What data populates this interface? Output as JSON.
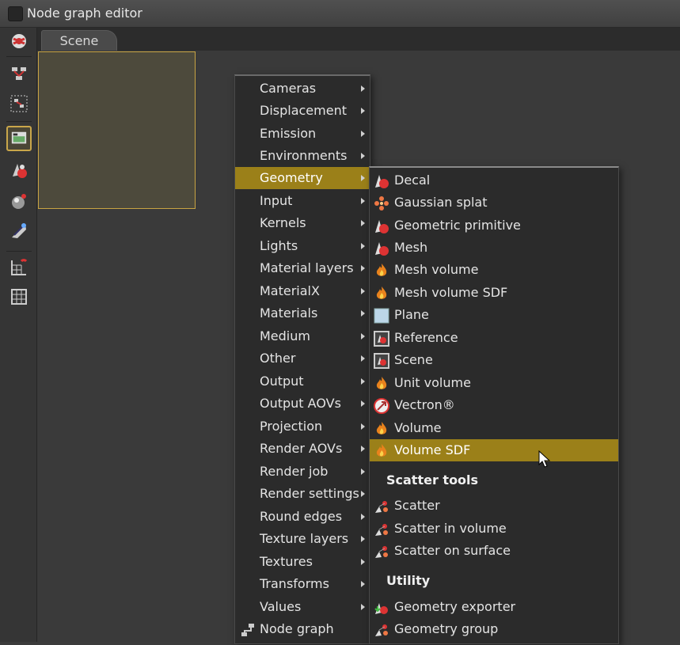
{
  "window": {
    "title": "Node graph editor"
  },
  "tabs": [
    {
      "label": "Scene"
    }
  ],
  "toolbar": {
    "icons": [
      "network-icon",
      "select-icon",
      "reorder-icon",
      "preview-icon",
      "material-icon",
      "render-icon",
      "camera-pick-icon",
      "grid-snap-icon",
      "grid-icon"
    ]
  },
  "main_menu": {
    "items": [
      {
        "label": "Cameras"
      },
      {
        "label": "Displacement"
      },
      {
        "label": "Emission"
      },
      {
        "label": "Environments"
      },
      {
        "label": "Geometry"
      },
      {
        "label": "Input"
      },
      {
        "label": "Kernels"
      },
      {
        "label": "Lights"
      },
      {
        "label": "Material layers"
      },
      {
        "label": "MaterialX"
      },
      {
        "label": "Materials"
      },
      {
        "label": "Medium"
      },
      {
        "label": "Other"
      },
      {
        "label": "Output"
      },
      {
        "label": "Output AOVs"
      },
      {
        "label": "Projection"
      },
      {
        "label": "Render AOVs"
      },
      {
        "label": "Render job"
      },
      {
        "label": "Render settings"
      },
      {
        "label": "Round edges"
      },
      {
        "label": "Texture layers"
      },
      {
        "label": "Textures"
      },
      {
        "label": "Transforms"
      },
      {
        "label": "Values"
      },
      {
        "label": "Node graph"
      }
    ],
    "highlighted": "Geometry"
  },
  "geometry_menu": {
    "items": [
      {
        "label": "Decal",
        "icon": "geometry-icon"
      },
      {
        "label": "Gaussian splat",
        "icon": "splat-icon"
      },
      {
        "label": "Geometric primitive",
        "icon": "geometry-icon"
      },
      {
        "label": "Mesh",
        "icon": "geometry-icon"
      },
      {
        "label": "Mesh volume",
        "icon": "flame-icon"
      },
      {
        "label": "Mesh volume SDF",
        "icon": "flame-icon"
      },
      {
        "label": "Plane",
        "icon": "plane-icon"
      },
      {
        "label": "Reference",
        "icon": "reference-icon"
      },
      {
        "label": "Scene",
        "icon": "reference-icon"
      },
      {
        "label": "Unit volume",
        "icon": "flame-icon"
      },
      {
        "label": "Vectron®",
        "icon": "vectron-icon"
      },
      {
        "label": "Volume",
        "icon": "flame-icon"
      },
      {
        "label": "Volume SDF",
        "icon": "flame-icon"
      }
    ],
    "highlighted": "Volume SDF",
    "scatter_header": "Scatter tools",
    "scatter_items": [
      {
        "label": "Scatter",
        "icon": "scatter-icon"
      },
      {
        "label": "Scatter in volume",
        "icon": "scatter-icon"
      },
      {
        "label": "Scatter on surface",
        "icon": "scatter-icon"
      }
    ],
    "utility_header": "Utility",
    "utility_items": [
      {
        "label": "Geometry exporter",
        "icon": "export-icon"
      },
      {
        "label": "Geometry group",
        "icon": "scatter-icon"
      }
    ]
  },
  "colors": {
    "highlight": "#9b8019",
    "node_border": "#c7a343"
  }
}
